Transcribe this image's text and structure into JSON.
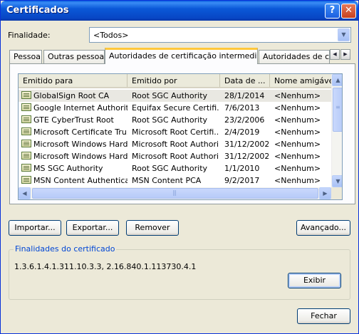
{
  "window": {
    "title": "Certificados",
    "help_glyph": "?",
    "close_glyph": "✕"
  },
  "purpose": {
    "label": "Finalidade:",
    "value": "<Todos>"
  },
  "tabs": [
    {
      "label": "Pessoal"
    },
    {
      "label": "Outras pessoas"
    },
    {
      "label": "Autoridades de certificação intermediárias"
    },
    {
      "label": "Autoridades de certificação"
    }
  ],
  "list": {
    "columns": [
      "Emitido para",
      "Emitido por",
      "Data de ...",
      "Nome amigável"
    ],
    "rows": [
      {
        "issued_to": "GlobalSign Root CA",
        "issued_by": "Root SGC Authority",
        "date": "28/1/2014",
        "friendly": "<Nenhum>"
      },
      {
        "issued_to": "Google Internet Authority",
        "issued_by": "Equifax Secure Certifi...",
        "date": "7/6/2013",
        "friendly": "<Nenhum>"
      },
      {
        "issued_to": "GTE CyberTrust Root",
        "issued_by": "Root SGC Authority",
        "date": "23/2/2006",
        "friendly": "<Nenhum>"
      },
      {
        "issued_to": "Microsoft Certificate Tru...",
        "issued_by": "Microsoft Root Certifi...",
        "date": "2/4/2019",
        "friendly": "<Nenhum>"
      },
      {
        "issued_to": "Microsoft Windows Hard...",
        "issued_by": "Microsoft Root Authority",
        "date": "31/12/2002",
        "friendly": "<Nenhum>"
      },
      {
        "issued_to": "Microsoft Windows Hard...",
        "issued_by": "Microsoft Root Authority",
        "date": "31/12/2002",
        "friendly": "<Nenhum>"
      },
      {
        "issued_to": "MS SGC Authority",
        "issued_by": "Root SGC Authority",
        "date": "1/1/2010",
        "friendly": "<Nenhum>"
      },
      {
        "issued_to": "MSN Content Authentica...",
        "issued_by": "MSN Content PCA",
        "date": "9/2/2017",
        "friendly": "<Nenhum>"
      }
    ]
  },
  "buttons": {
    "import": "Importar...",
    "export": "Exportar...",
    "remove": "Remover",
    "advanced": "Avançado...",
    "view": "Exibir",
    "close": "Fechar"
  },
  "purposes_group": {
    "label": "Finalidades do certificado",
    "value": "1.3.6.1.4.1.311.10.3.3, 2.16.840.1.113730.4.1"
  }
}
